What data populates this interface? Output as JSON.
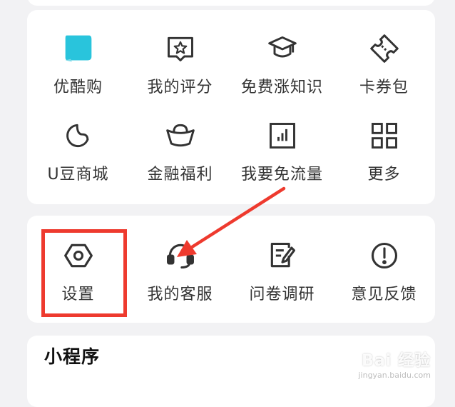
{
  "menu1": {
    "items": [
      {
        "label": "优酷购",
        "icon": "youku-shop-icon"
      },
      {
        "label": "我的评分",
        "icon": "rating-star-icon"
      },
      {
        "label": "免费涨知识",
        "icon": "graduation-cap-icon"
      },
      {
        "label": "卡券包",
        "icon": "coupon-ticket-icon"
      },
      {
        "label": "U豆商城",
        "icon": "u-bean-icon"
      },
      {
        "label": "金融福利",
        "icon": "ingot-icon"
      },
      {
        "label": "我要免流量",
        "icon": "data-chart-icon"
      },
      {
        "label": "更多",
        "icon": "grid-more-icon"
      }
    ]
  },
  "menu2": {
    "items": [
      {
        "label": "设置",
        "icon": "settings-icon"
      },
      {
        "label": "我的客服",
        "icon": "customer-service-icon"
      },
      {
        "label": "问卷调研",
        "icon": "survey-icon"
      },
      {
        "label": "意见反馈",
        "icon": "feedback-icon"
      }
    ]
  },
  "mini_programs": {
    "title": "小程序"
  },
  "watermark": {
    "main": "Bai 经验",
    "sub": "jingyan.baidu.com"
  },
  "colors": {
    "highlight": "#ee3a2e",
    "icon": "#333333",
    "youku_accent": "#29c4dc"
  }
}
